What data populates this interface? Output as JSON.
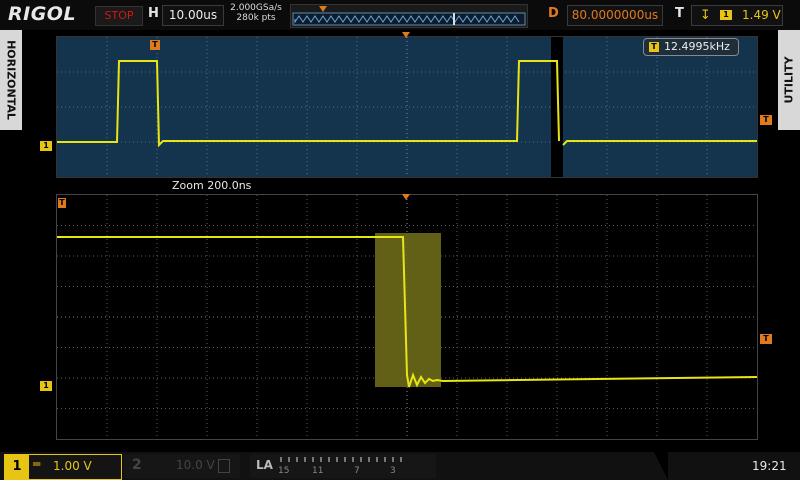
{
  "top": {
    "logo": "RIGOL",
    "status": "STOP",
    "h_letter": "H",
    "timebase": "10.00us",
    "sample_rate": "2.000GSa/s",
    "memory_depth": "280k pts",
    "d_letter": "D",
    "delay": "80.0000000us",
    "t_letter": "T",
    "trigger_source": "1",
    "trigger_level": "1.49 V"
  },
  "side": {
    "left_tab": "HORIZONTAL",
    "right_tab": "UTILITY"
  },
  "main": {
    "frequency_source": "T",
    "frequency": "12.4995kHz",
    "ch_marker": "1",
    "trig_marker": "T"
  },
  "zoom": {
    "label": "Zoom  200.0ns",
    "ch_marker": "1",
    "trig_marker": "T"
  },
  "bottom": {
    "ch1_num": "1",
    "ch1_scale": "1.00 V",
    "ch2_num": "2",
    "ch2_scale": "10.0 V",
    "la_label": "LA",
    "la_groups": [
      "15",
      "11",
      "7",
      "3"
    ],
    "clock": "19:21"
  },
  "colors": {
    "trace": "#e8e514",
    "main_bg": "#14334d",
    "delay_text": "#e07a1e",
    "stop_text": "#d21818"
  }
}
